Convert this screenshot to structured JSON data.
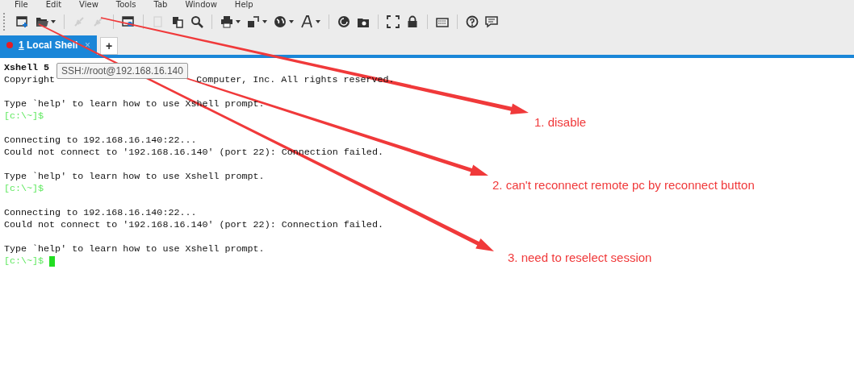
{
  "menu": [
    "File",
    "Edit",
    "View",
    "Tools",
    "Tab",
    "Window",
    "Help"
  ],
  "toolbar_groups": [
    [
      {
        "disabled": false,
        "dropdown": false
      },
      {
        "disabled": false,
        "dropdown": true
      }
    ],
    [
      {
        "disabled": true,
        "dropdown": false
      },
      {
        "disabled": true,
        "dropdown": false
      }
    ],
    [
      {
        "disabled": false,
        "dropdown": false
      }
    ],
    [
      {
        "disabled": true,
        "dropdown": false
      },
      {
        "disabled": false,
        "dropdown": false
      },
      {
        "disabled": false,
        "dropdown": false
      }
    ],
    [
      {
        "disabled": false,
        "dropdown": true
      },
      {
        "disabled": false,
        "dropdown": true
      },
      {
        "disabled": false,
        "dropdown": true
      },
      {
        "disabled": false,
        "dropdown": true
      }
    ],
    [
      {
        "disabled": false,
        "dropdown": false
      },
      {
        "disabled": false,
        "dropdown": false
      }
    ],
    [
      {
        "disabled": false,
        "dropdown": false
      },
      {
        "disabled": false,
        "dropdown": false
      }
    ],
    [
      {
        "disabled": false,
        "dropdown": false
      }
    ],
    [
      {
        "disabled": false,
        "dropdown": false
      },
      {
        "disabled": false,
        "dropdown": false
      }
    ]
  ],
  "tabs": [
    {
      "number": "1",
      "label": "Local Shell",
      "selected": true,
      "close": "×"
    }
  ],
  "new_tab": "+",
  "terminal": [
    {
      "kind": "bold",
      "text": "Xshell 5"
    },
    {
      "kind": "covered",
      "parts": [
        "Copyright",
        "Computer, Inc. All rights reserved."
      ]
    },
    {
      "kind": "blank"
    },
    {
      "kind": "plain",
      "text": "Type `help' to learn how to use Xshell prompt."
    },
    {
      "kind": "prompt",
      "text": "[c:\\~]$",
      "cursor": false
    },
    {
      "kind": "blank"
    },
    {
      "kind": "plain",
      "text": "Connecting to 192.168.16.140:22..."
    },
    {
      "kind": "plain",
      "text": "Could not connect to '192.168.16.140' (port 22): Connection failed."
    },
    {
      "kind": "blank"
    },
    {
      "kind": "plain",
      "text": "Type `help' to learn how to use Xshell prompt."
    },
    {
      "kind": "prompt",
      "text": "[c:\\~]$",
      "cursor": false
    },
    {
      "kind": "blank"
    },
    {
      "kind": "plain",
      "text": "Connecting to 192.168.16.140:22..."
    },
    {
      "kind": "plain",
      "text": "Could not connect to '192.168.16.140' (port 22): Connection failed."
    },
    {
      "kind": "blank"
    },
    {
      "kind": "plain",
      "text": "Type `help' to learn how to use Xshell prompt."
    },
    {
      "kind": "prompt",
      "text": "[c:\\~]$",
      "cursor": true
    }
  ],
  "tooltip": "SSH://root@192.168.16.140",
  "annotations": [
    {
      "label": "1. disable"
    },
    {
      "label": "2. can't reconnect remote pc by reconnect button"
    },
    {
      "label": "3. need to reselect session"
    }
  ]
}
